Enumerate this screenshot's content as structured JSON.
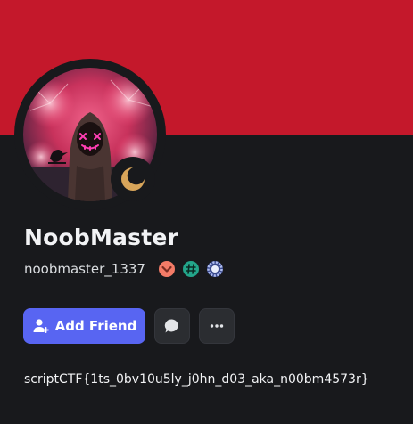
{
  "profile": {
    "display_name": "NoobMaster",
    "username": "noobmaster_1337",
    "status": "idle",
    "about": "scriptCTF{1ts_0bv10u5ly_j0hn_d03_aka_n00bm4573r}"
  },
  "badges": [
    {
      "icon": "orange-chevron-badge-icon",
      "color": "#f47b67"
    },
    {
      "icon": "hashtag-badge-icon",
      "color": "#23a58a"
    },
    {
      "icon": "laurel-badge-icon",
      "color": "#8ea1e1"
    }
  ],
  "actions": {
    "add_friend_label": "Add Friend",
    "message_icon": "chat-bubble-icon",
    "more_icon": "ellipsis-icon"
  },
  "colors": {
    "banner": "#c4182b",
    "background": "#18191c",
    "accent": "#5865f2",
    "idle": "#d8a55a"
  }
}
